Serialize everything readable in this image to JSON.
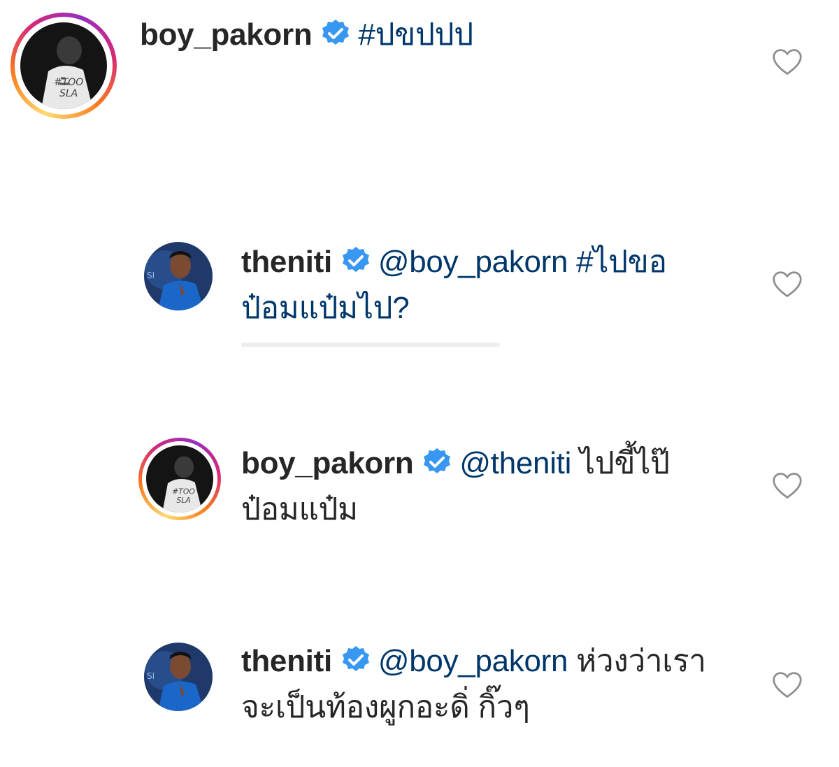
{
  "colors": {
    "verified": "#3897f0",
    "link": "#00376b",
    "text": "#262626",
    "heart_outline": "#8e8e8e"
  },
  "comments": [
    {
      "username": "boy_pakorn",
      "verified": true,
      "mention": "",
      "hashtag": "#ปขปปป",
      "text": "",
      "avatar": "boy-pakorn-avatar",
      "story_ring": true
    },
    {
      "username": "theniti",
      "verified": true,
      "mention": "@boy_pakorn",
      "hashtag": "#ไปขอ",
      "text": "ป๋อมแป๋มไป?",
      "avatar": "theniti-avatar",
      "story_ring": false
    },
    {
      "username": "boy_pakorn",
      "verified": true,
      "mention": "@theniti",
      "hashtag": "",
      "text": "ไปขี้ไป๊",
      "text_line2": "ป๋อมแป๋ม",
      "avatar": "boy-pakorn-avatar",
      "story_ring": true
    },
    {
      "username": "theniti",
      "verified": true,
      "mention": "@boy_pakorn",
      "hashtag": "",
      "text": "ห่วงว่าเรา",
      "text_line2": "จะเป็นท้องผูกอะดิ่ กิ๊วๆ",
      "avatar": "theniti-avatar",
      "story_ring": false
    }
  ],
  "icons": {
    "like": "heart-outline-icon",
    "verified": "verified-badge-icon"
  }
}
